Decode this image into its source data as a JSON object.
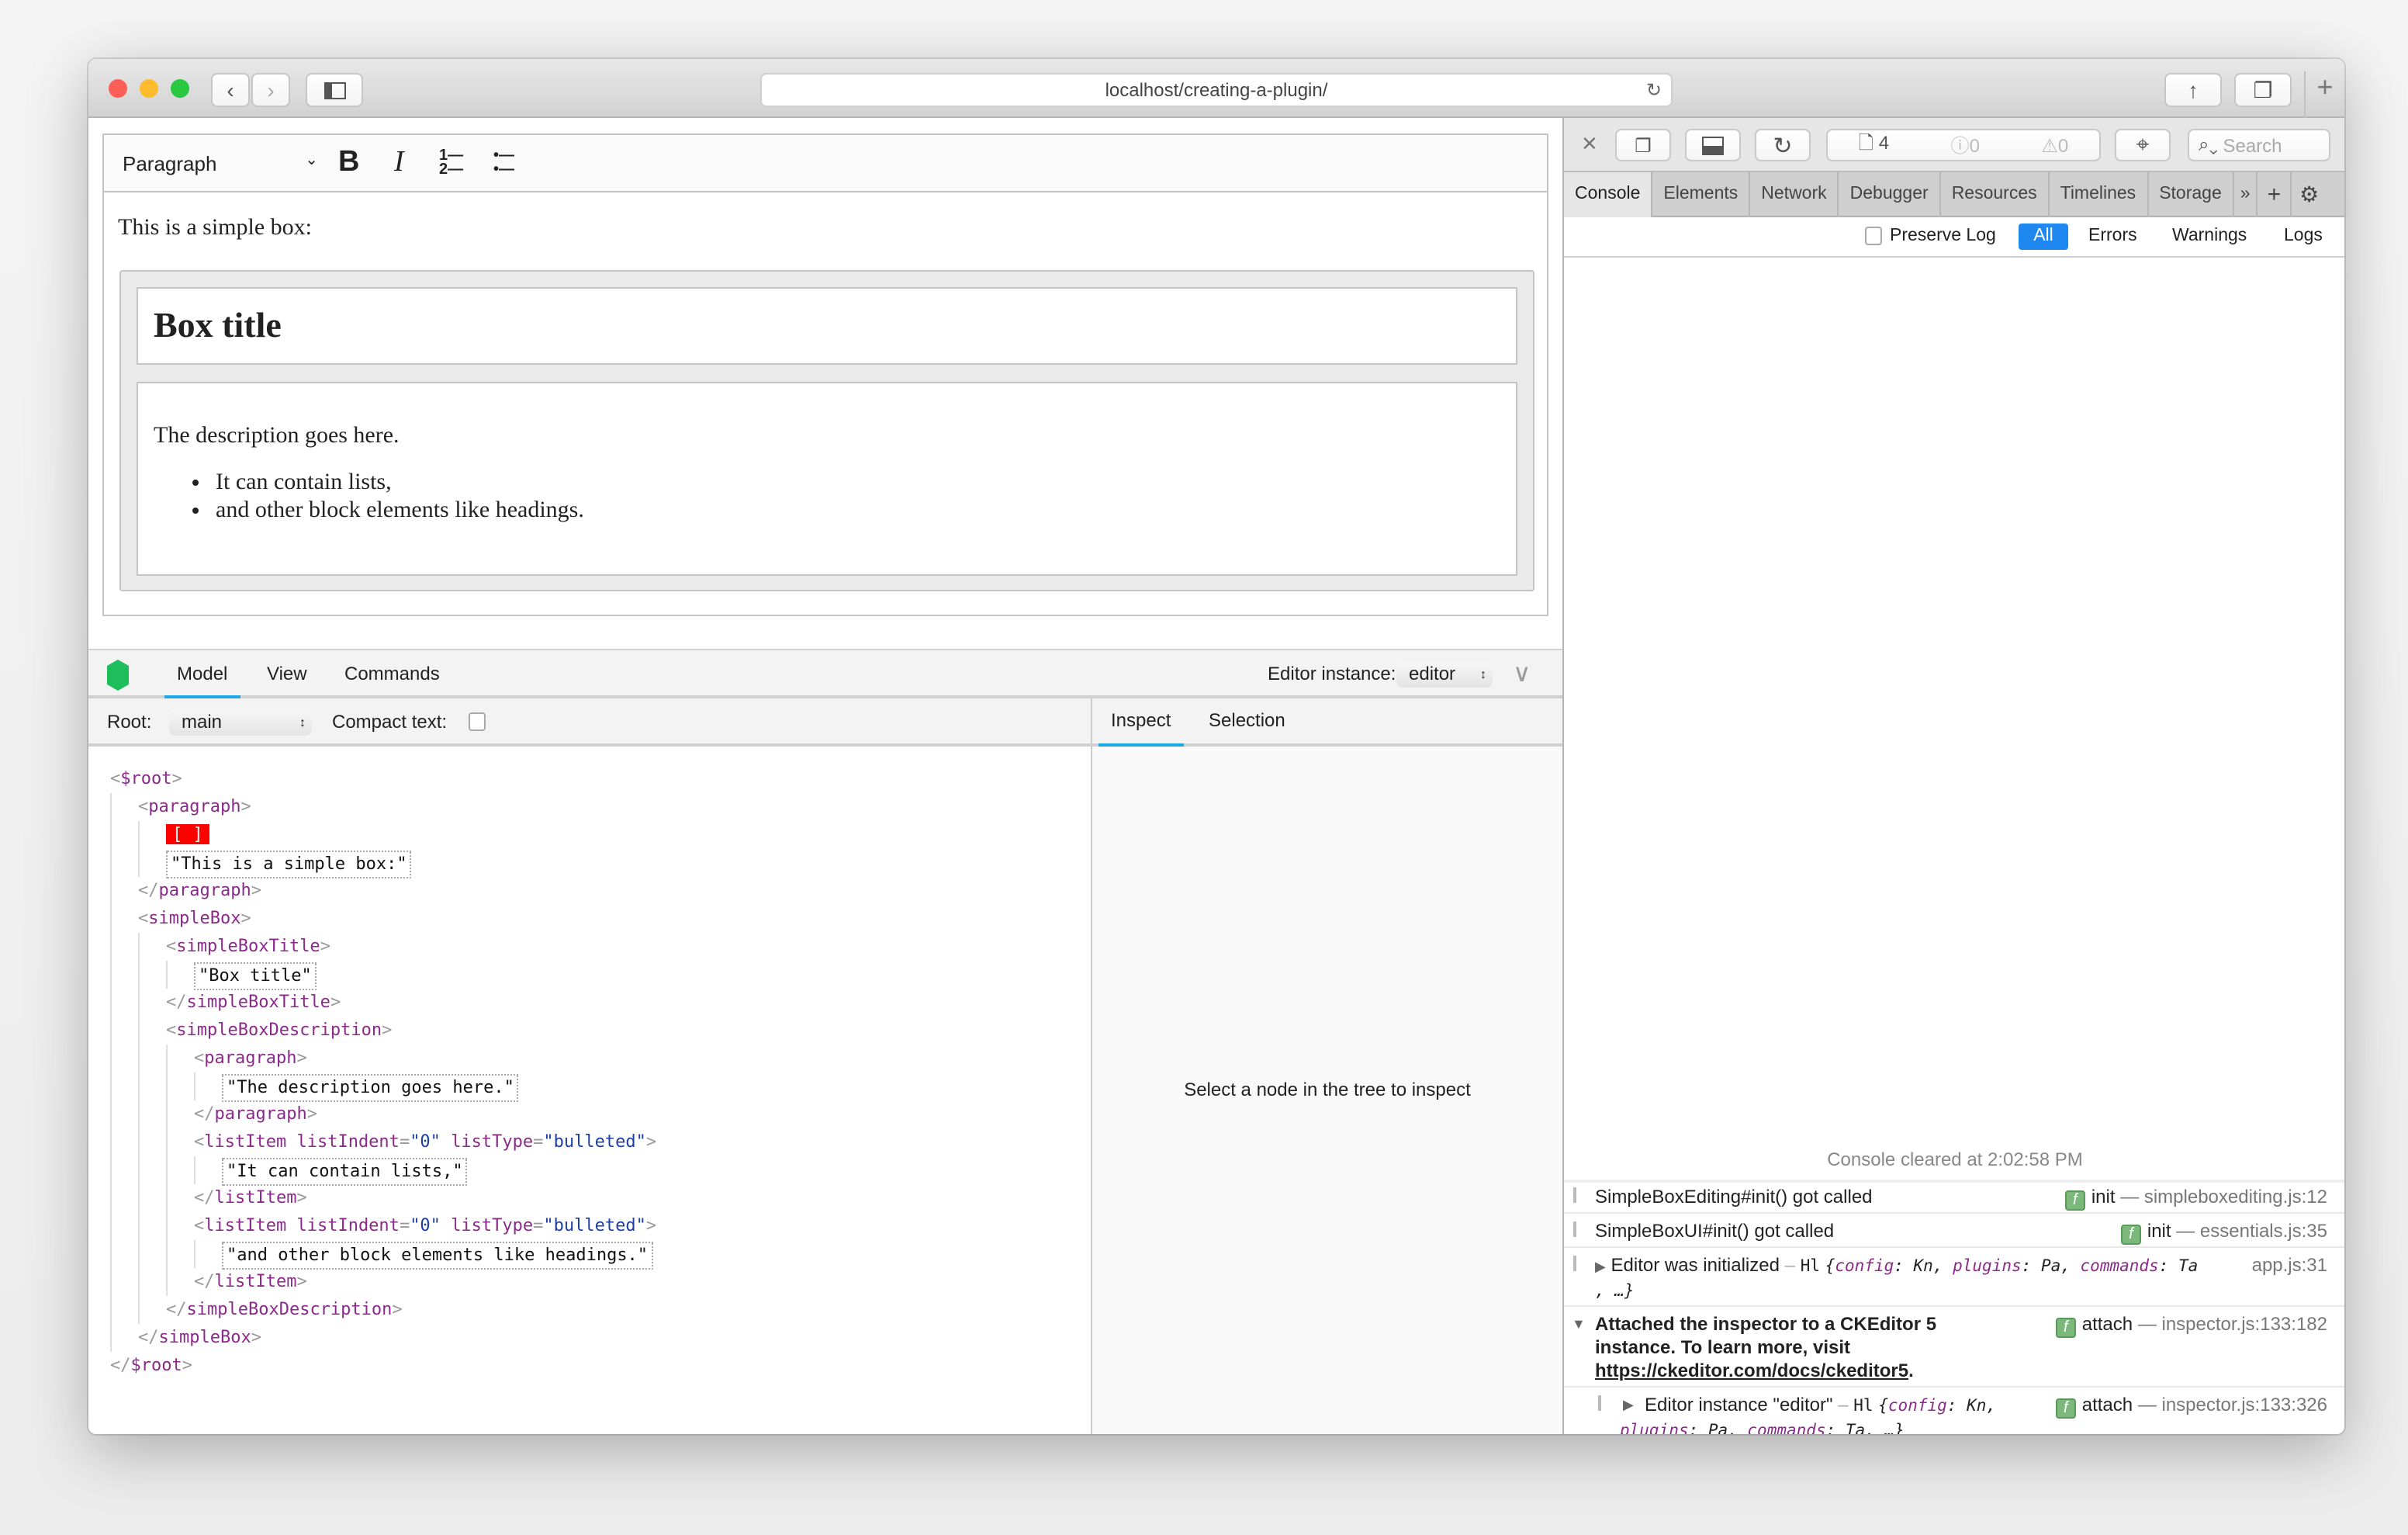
{
  "browser": {
    "url": "localhost/creating-a-plugin/"
  },
  "editor": {
    "toolbar": {
      "heading": "Paragraph",
      "bold": "B",
      "italic": "I"
    },
    "intro": "This is a simple box:",
    "box_title": "Box title",
    "box_description": "The description goes here.",
    "list": [
      "It can contain lists,",
      "and other block elements like headings."
    ]
  },
  "inspector": {
    "tabs": [
      "Model",
      "View",
      "Commands"
    ],
    "active_tab": "Model",
    "instance_label": "Editor instance:",
    "instance_value": "editor",
    "root_label": "Root:",
    "root_value": "main",
    "compact_label": "Compact text:",
    "side_tabs": [
      "Inspect",
      "Selection"
    ],
    "side_placeholder": "Select a node in the tree to inspect",
    "tree": {
      "name": "$root",
      "children": [
        {
          "name": "paragraph",
          "children": [
            {
              "selection": "[ ]"
            },
            {
              "text": "\"This is a simple box:\""
            }
          ]
        },
        {
          "name": "simpleBox",
          "children": [
            {
              "name": "simpleBoxTitle",
              "children": [
                {
                  "text": "\"Box title\""
                }
              ]
            },
            {
              "name": "simpleBoxDescription",
              "children": [
                {
                  "name": "paragraph",
                  "children": [
                    {
                      "text": "\"The description goes here.\""
                    }
                  ]
                },
                {
                  "name": "listItem",
                  "attrs": [
                    [
                      "listIndent",
                      "\"0\""
                    ],
                    [
                      "listType",
                      "\"bulleted\""
                    ]
                  ],
                  "children": [
                    {
                      "text": "\"It can contain lists,\""
                    }
                  ]
                },
                {
                  "name": "listItem",
                  "attrs": [
                    [
                      "listIndent",
                      "\"0\""
                    ],
                    [
                      "listType",
                      "\"bulleted\""
                    ]
                  ],
                  "children": [
                    {
                      "text": "\"and other block elements like headings.\""
                    }
                  ]
                }
              ]
            }
          ]
        }
      ]
    }
  },
  "devtools": {
    "resource_count": "4",
    "error_count": "0",
    "warning_count": "0",
    "search_placeholder": "Search",
    "tabs": [
      "Console",
      "Elements",
      "Network",
      "Debugger",
      "Resources",
      "Timelines",
      "Storage"
    ],
    "active_tab": "Console",
    "filter": {
      "preserve_log": "Preserve Log",
      "all": "All",
      "errors": "Errors",
      "warnings": "Warnings",
      "logs": "Logs"
    },
    "cleared": "Console cleared at 2:02:58 PM",
    "entries": [
      {
        "text": "SimpleBoxEditing#init() got called",
        "func": "init",
        "source": "simpleboxediting.js:12"
      },
      {
        "text": "SimpleBoxUI#init() got called",
        "func": "init",
        "source": "essentials.js:35"
      },
      {
        "text": "Editor was initialized",
        "obj": "Hl",
        "source": "app.js:31"
      },
      {
        "text": "Attached the inspector to a CKEditor 5 instance. To learn more, visit",
        "link": "https://ckeditor.com/docs/ckeditor5",
        "func": "attach",
        "source": "inspector.js:133:182"
      },
      {
        "text": "Editor instance \"editor\"",
        "obj": "Hl",
        "func": "attach",
        "source": "inspector.js:133:326"
      }
    ]
  },
  "colors": {
    "accent": "#1ea7e6",
    "devtools_blue": "#1e87f0",
    "ck_green": "#1ebe5a",
    "selection": "#ff0000",
    "tag": "#8b2a8b"
  }
}
